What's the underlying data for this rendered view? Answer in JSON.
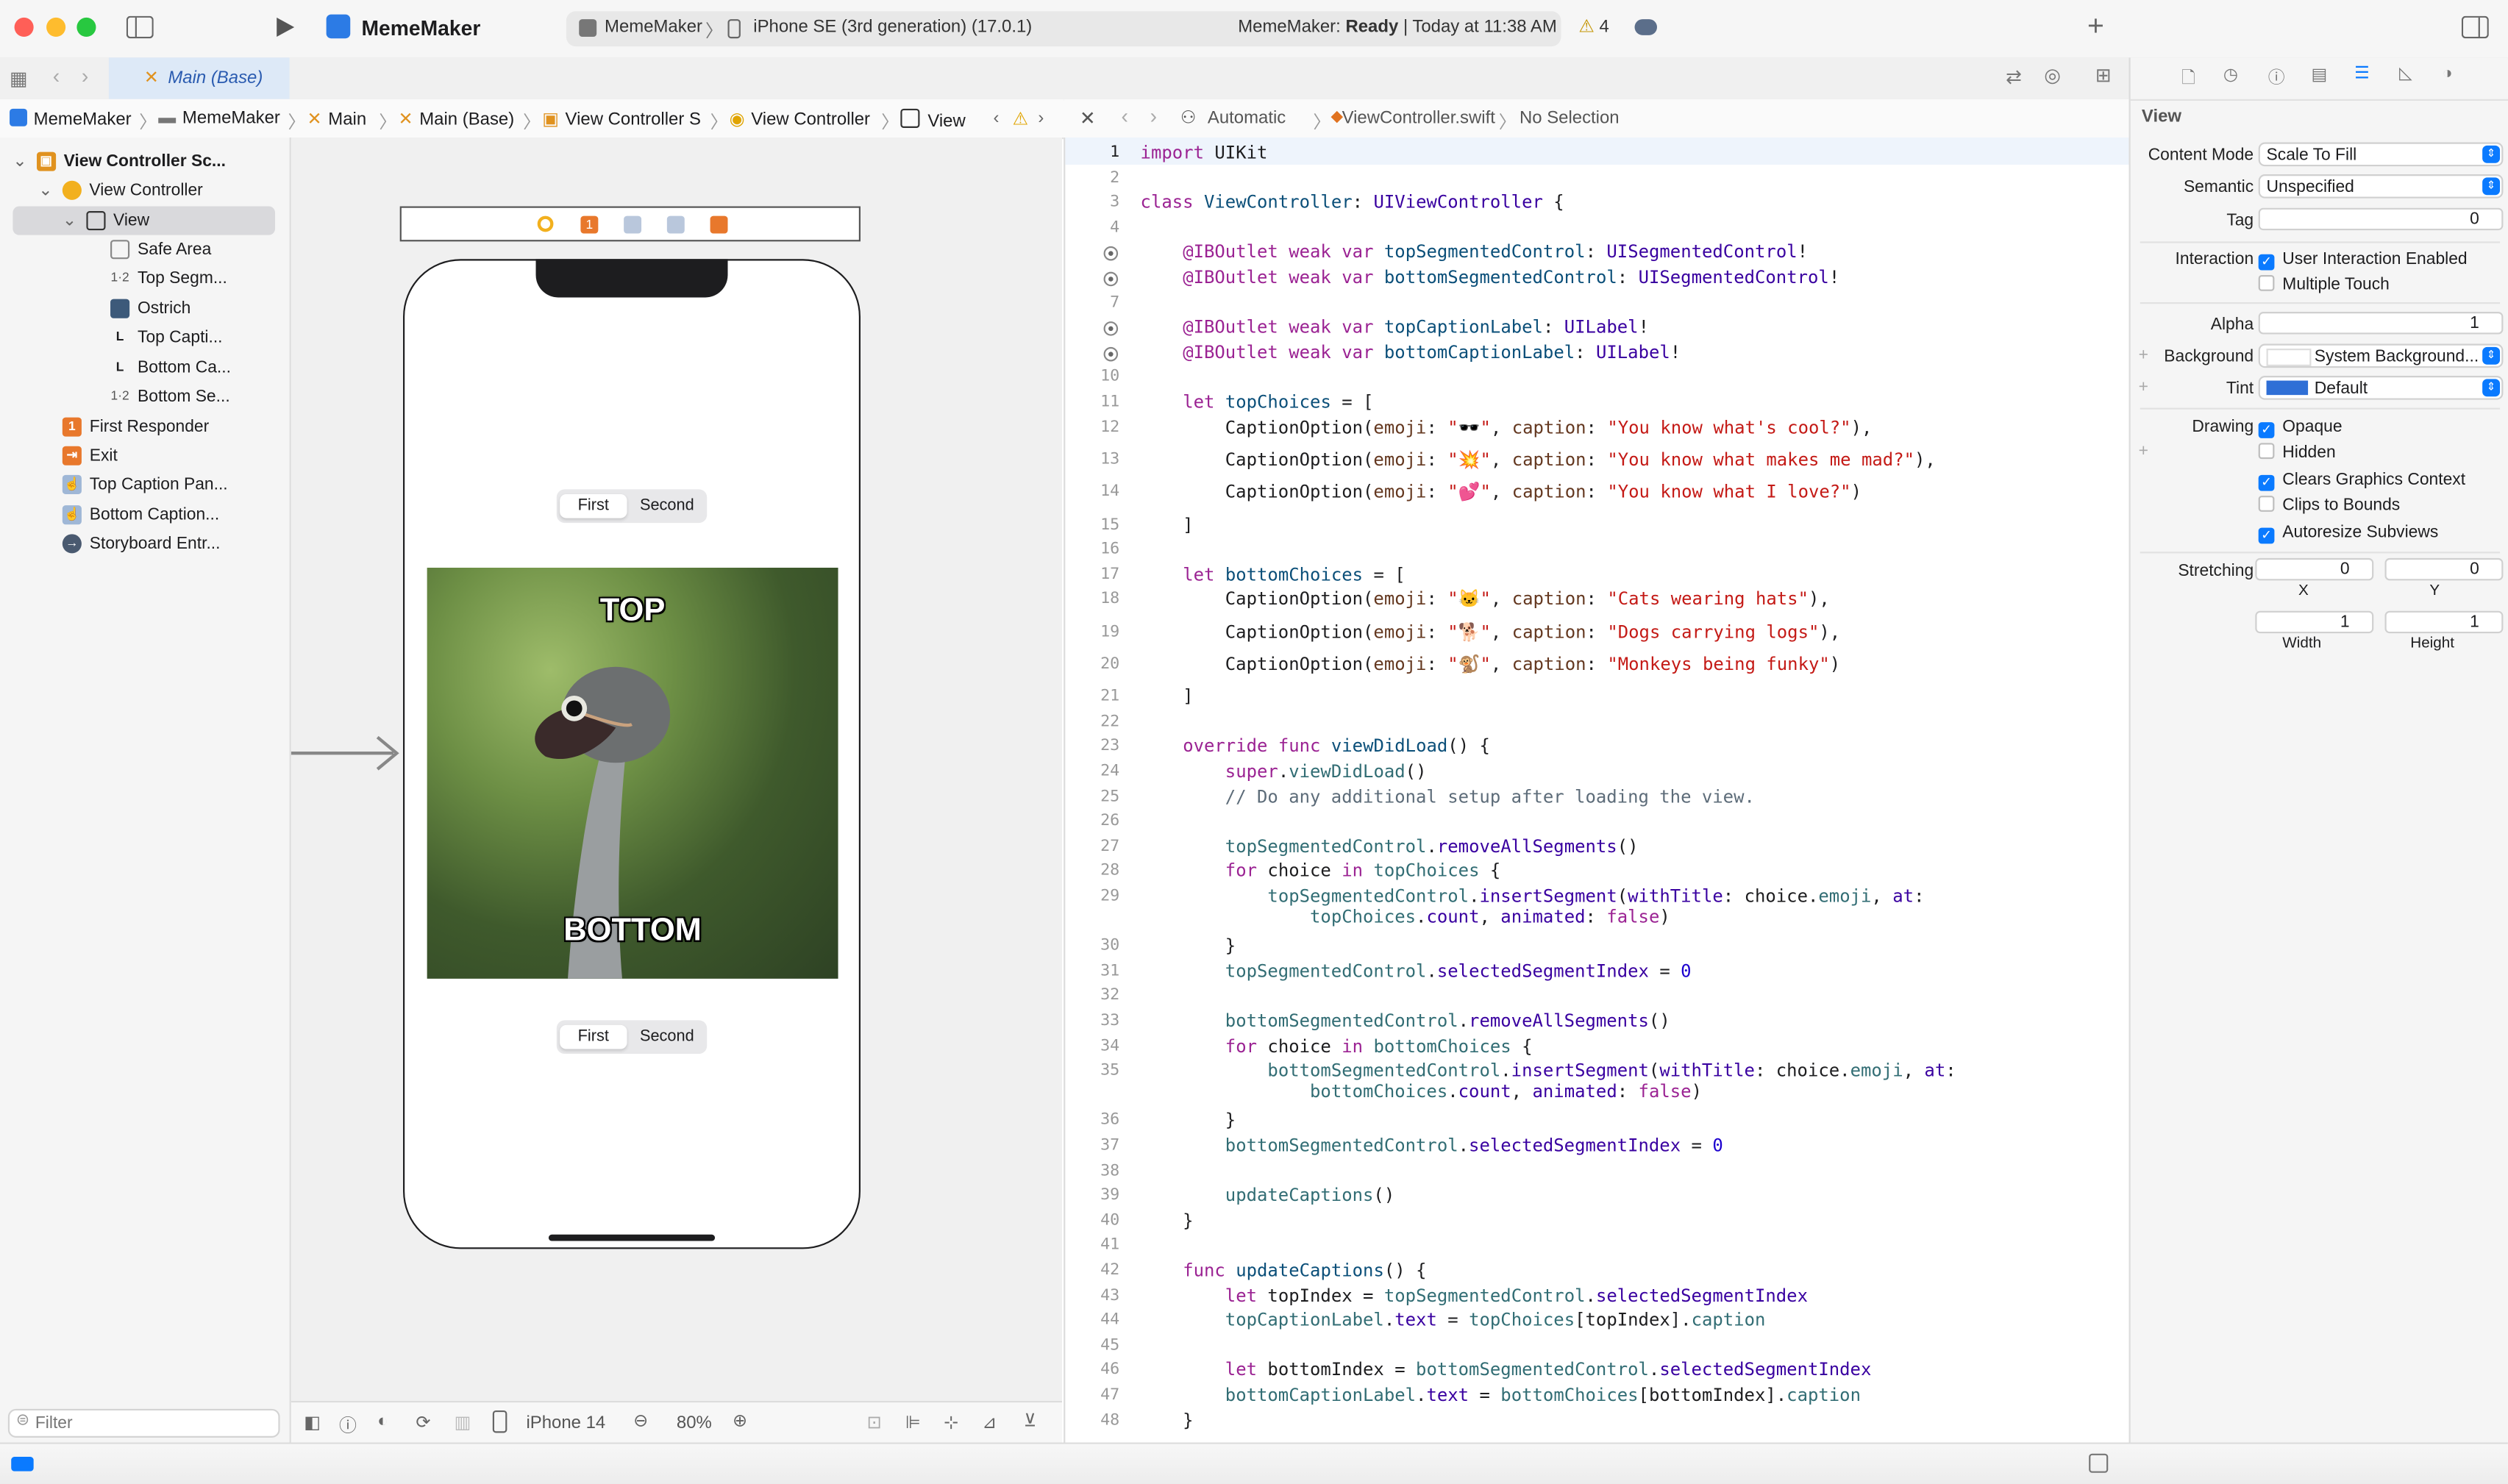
{
  "toolbar": {
    "project": "MemeMaker",
    "scheme": "MemeMaker",
    "device": "iPhone SE (3rd generation) (17.0.1)",
    "status_app": "MemeMaker:",
    "status_state": "Ready",
    "status_time": "| Today at 11:38 AM",
    "warning_count": "4"
  },
  "tabs": {
    "active": "Main (Base)"
  },
  "breadcrumb": {
    "items": [
      "MemeMaker",
      "MemeMaker",
      "Main",
      "Main (Base)",
      "View Controller S",
      "View Controller",
      "View"
    ]
  },
  "editor_crumb": {
    "mode": "Automatic",
    "file": "ViewController.swift",
    "selection": "No Selection"
  },
  "navigator": {
    "items": [
      {
        "label": "View Controller Sc...",
        "icon": "scene-icon"
      },
      {
        "label": "View Controller",
        "icon": "view-controller-icon"
      },
      {
        "label": "View",
        "icon": "view-icon"
      },
      {
        "label": "Safe Area",
        "icon": "safe-area-icon"
      },
      {
        "label": "Top Segm...",
        "icon": "segmented-control-icon"
      },
      {
        "label": "Ostrich",
        "icon": "image-view-icon"
      },
      {
        "label": "Top Capti...",
        "icon": "label-icon"
      },
      {
        "label": "Bottom Ca...",
        "icon": "label-icon"
      },
      {
        "label": "Bottom Se...",
        "icon": "segmented-control-icon"
      },
      {
        "label": "First Responder",
        "icon": "first-responder-icon"
      },
      {
        "label": "Exit",
        "icon": "exit-icon"
      },
      {
        "label": "Top Caption Pan...",
        "icon": "gesture-icon"
      },
      {
        "label": "Bottom Caption...",
        "icon": "gesture-icon"
      },
      {
        "label": "Storyboard Entr...",
        "icon": "entry-point-icon"
      }
    ],
    "filter_placeholder": "Filter"
  },
  "canvas": {
    "seg_first": "First",
    "seg_second": "Second",
    "meme_top": "TOP",
    "meme_bottom": "BOTTOM",
    "device": "iPhone 14",
    "zoom": "80%"
  },
  "code": {
    "lines": [
      {
        "n": "1",
        "h": "<span class='k'>import</span> UIKit"
      },
      {
        "n": "2",
        "h": ""
      },
      {
        "n": "3",
        "h": "<span class='k'>class</span> <span class='t'>ViewController</span>: <span class='m'>UIViewController</span> {"
      },
      {
        "n": "4",
        "h": ""
      },
      {
        "n": "5",
        "h": "    <span class='k'>@IBOutlet</span> <span class='k'>weak</span> <span class='k'>var</span> <span class='t'>topSegmentedControl</span>: <span class='m'>UISegmentedControl</span>!"
      },
      {
        "n": "6",
        "h": "    <span class='k'>@IBOutlet</span> <span class='k'>weak</span> <span class='k'>var</span> <span class='t'>bottomSegmentedControl</span>: <span class='m'>UISegmentedControl</span>!"
      },
      {
        "n": "7",
        "h": ""
      },
      {
        "n": "8",
        "h": "    <span class='k'>@IBOutlet</span> <span class='k'>weak</span> <span class='k'>var</span> <span class='t'>topCaptionLabel</span>: <span class='m'>UILabel</span>!"
      },
      {
        "n": "9",
        "h": "    <span class='k'>@IBOutlet</span> <span class='k'>weak</span> <span class='k'>var</span> <span class='t'>bottomCaptionLabel</span>: <span class='m'>UILabel</span>!"
      },
      {
        "n": "10",
        "h": ""
      },
      {
        "n": "11",
        "h": "    <span class='k'>let</span> <span class='t'>topChoices</span> = ["
      },
      {
        "n": "12",
        "h": "        CaptionOption(<span class='a'>emoji</span>: <span class='s'>\"🕶️\"</span>, <span class='a'>caption</span>: <span class='s'>\"You know what's cool?\"</span>),"
      },
      {
        "n": "13",
        "h": "        CaptionOption(<span class='a'>emoji</span>: <span class='s'>\"💥\"</span>, <span class='a'>caption</span>: <span class='s'>\"You know what makes me mad?\"</span>),"
      },
      {
        "n": "14",
        "h": "        CaptionOption(<span class='a'>emoji</span>: <span class='s'>\"💕\"</span>, <span class='a'>caption</span>: <span class='s'>\"You know what I love?\"</span>)"
      },
      {
        "n": "15",
        "h": "    ]"
      },
      {
        "n": "16",
        "h": ""
      },
      {
        "n": "17",
        "h": "    <span class='k'>let</span> <span class='t'>bottomChoices</span> = ["
      },
      {
        "n": "18",
        "h": "        CaptionOption(<span class='a'>emoji</span>: <span class='s'>\"🐱\"</span>, <span class='a'>caption</span>: <span class='s'>\"Cats wearing hats\"</span>),"
      },
      {
        "n": "19",
        "h": "        CaptionOption(<span class='a'>emoji</span>: <span class='s'>\"🐕\"</span>, <span class='a'>caption</span>: <span class='s'>\"Dogs carrying logs\"</span>),"
      },
      {
        "n": "20",
        "h": "        CaptionOption(<span class='a'>emoji</span>: <span class='s'>\"🐒\"</span>, <span class='a'>caption</span>: <span class='s'>\"Monkeys being funky\"</span>)"
      },
      {
        "n": "21",
        "h": "    ]"
      },
      {
        "n": "22",
        "h": ""
      },
      {
        "n": "23",
        "h": "    <span class='k'>override</span> <span class='k'>func</span> <span class='t'>viewDidLoad</span>() {"
      },
      {
        "n": "24",
        "h": "        <span class='k'>super</span>.<span class='p'>viewDidLoad</span>()"
      },
      {
        "n": "25",
        "h": "        <span class='c'>// Do any additional setup after loading the view.</span>"
      },
      {
        "n": "26",
        "h": ""
      },
      {
        "n": "27",
        "h": "        <span class='p'>topSegmentedControl</span>.<span class='m'>removeAllSegments</span>()"
      },
      {
        "n": "28",
        "h": "        <span class='k'>for</span> choice <span class='k'>in</span> <span class='p'>topChoices</span> {"
      },
      {
        "n": "29",
        "h": "            <span class='p'>topSegmentedControl</span>.<span class='m'>insertSegment</span>(<span class='m'>withTitle</span>: choice.<span class='p'>emoji</span>, <span class='m'>at</span>:\n                <span class='p'>topChoices</span>.<span class='m'>count</span>, <span class='m'>animated</span>: <span class='k'>false</span>)"
      },
      {
        "n": "30",
        "h": "        }"
      },
      {
        "n": "31",
        "h": "        <span class='p'>topSegmentedControl</span>.<span class='m'>selectedSegmentIndex</span> = <span class='n'>0</span>"
      },
      {
        "n": "32",
        "h": ""
      },
      {
        "n": "33",
        "h": "        <span class='p'>bottomSegmentedControl</span>.<span class='m'>removeAllSegments</span>()"
      },
      {
        "n": "34",
        "h": "        <span class='k'>for</span> choice <span class='k'>in</span> <span class='p'>bottomChoices</span> {"
      },
      {
        "n": "35",
        "h": "            <span class='p'>bottomSegmentedControl</span>.<span class='m'>insertSegment</span>(<span class='m'>withTitle</span>: choice.<span class='p'>emoji</span>, <span class='m'>at</span>:\n                <span class='p'>bottomChoices</span>.<span class='m'>count</span>, <span class='m'>animated</span>: <span class='k'>false</span>)"
      },
      {
        "n": "36",
        "h": "        }"
      },
      {
        "n": "37",
        "h": "        <span class='p'>bottomSegmentedControl</span>.<span class='m'>selectedSegmentIndex</span> = <span class='n'>0</span>"
      },
      {
        "n": "38",
        "h": ""
      },
      {
        "n": "39",
        "h": "        <span class='p'>updateCaptions</span>()"
      },
      {
        "n": "40",
        "h": "    }"
      },
      {
        "n": "41",
        "h": ""
      },
      {
        "n": "42",
        "h": "    <span class='k'>func</span> <span class='t'>updateCaptions</span>() {"
      },
      {
        "n": "43",
        "h": "        <span class='k'>let</span> topIndex = <span class='p'>topSegmentedControl</span>.<span class='m'>selectedSegmentIndex</span>"
      },
      {
        "n": "44",
        "h": "        <span class='p'>topCaptionLabel</span>.<span class='m'>text</span> = <span class='p'>topChoices</span>[topIndex].<span class='p'>caption</span>"
      },
      {
        "n": "45",
        "h": ""
      },
      {
        "n": "46",
        "h": "        <span class='k'>let</span> bottomIndex = <span class='p'>bottomSegmentedControl</span>.<span class='m'>selectedSegmentIndex</span>"
      },
      {
        "n": "47",
        "h": "        <span class='p'>bottomCaptionLabel</span>.<span class='m'>text</span> = <span class='p'>bottomChoices</span>[bottomIndex].<span class='p'>caption</span>"
      },
      {
        "n": "48",
        "h": "    }"
      }
    ]
  },
  "inspector": {
    "title": "View",
    "content_mode_label": "Content Mode",
    "content_mode": "Scale To Fill",
    "semantic_label": "Semantic",
    "semantic": "Unspecified",
    "tag_label": "Tag",
    "tag": "0",
    "interaction_label": "Interaction",
    "user_interaction": "User Interaction Enabled",
    "multiple_touch": "Multiple Touch",
    "alpha_label": "Alpha",
    "alpha": "1",
    "background_label": "Background",
    "background": "System Background...",
    "tint_label": "Tint",
    "tint": "Default",
    "drawing_label": "Drawing",
    "opaque": "Opaque",
    "hidden": "Hidden",
    "clears": "Clears Graphics Context",
    "clips": "Clips to Bounds",
    "autoresize": "Autoresize Subviews",
    "stretching_label": "Stretching",
    "sx": "0",
    "sy": "0",
    "x_label": "X",
    "y_label": "Y",
    "sw": "1",
    "sh": "1",
    "w_label": "Width",
    "h_label": "Height"
  }
}
